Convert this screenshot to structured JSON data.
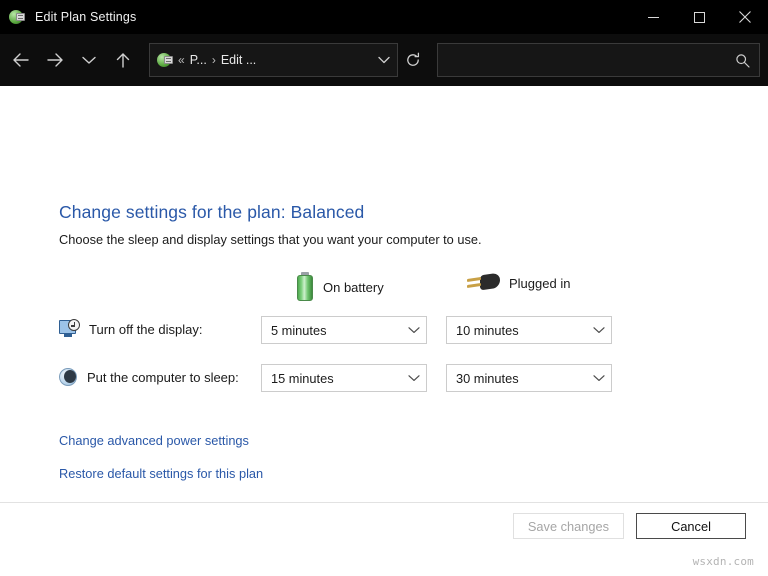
{
  "window": {
    "title": "Edit Plan Settings",
    "icon": "power-plan-icon",
    "controls": {
      "minimize": "minimize-button",
      "maximize": "maximize-button",
      "close": "close-button"
    }
  },
  "navbar": {
    "back": "back-arrow-icon",
    "forward": "forward-arrow-icon",
    "recent": "chevron-down-icon",
    "up": "up-arrow-icon",
    "breadcrumb": {
      "icon": "power-plan-icon",
      "overflow": "«",
      "segments": [
        "P...",
        "Edit ..."
      ],
      "separator": "›",
      "dropdown": "chevron-down-icon"
    },
    "refresh": "refresh-icon",
    "search": {
      "value": "",
      "placeholder": "",
      "icon": "search-icon"
    }
  },
  "main": {
    "heading": "Change settings for the plan: Balanced",
    "subheading": "Choose the sleep and display settings that you want your computer to use.",
    "columns": [
      {
        "label": "On battery",
        "icon": "battery-icon"
      },
      {
        "label": "Plugged in",
        "icon": "power-plug-icon"
      }
    ],
    "rows": [
      {
        "label": "Turn off the display:",
        "icon": "display-clock-icon",
        "on_battery": "5 minutes",
        "plugged_in": "10 minutes"
      },
      {
        "label": "Put the computer to sleep:",
        "icon": "sleep-moon-icon",
        "on_battery": "15 minutes",
        "plugged_in": "30 minutes"
      }
    ],
    "links": [
      "Change advanced power settings",
      "Restore default settings for this plan"
    ]
  },
  "footer": {
    "save_label": "Save changes",
    "save_disabled": true,
    "cancel_label": "Cancel"
  },
  "watermark": "wsxdn.com",
  "colors": {
    "titlebar": "#000000",
    "navbar": "#0d0d0d",
    "content": "#ffffff",
    "link": "#2a58a8",
    "heading": "#2a58a8",
    "battery_green": "#5aa83f"
  }
}
